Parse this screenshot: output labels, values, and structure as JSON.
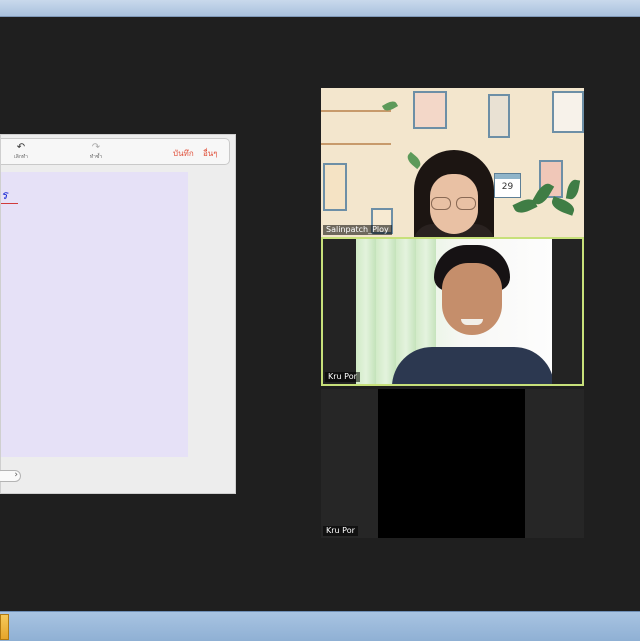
{
  "shared_screen": {
    "toolbar": {
      "undo_label": "เลิกทำ",
      "redo_label": "ทำซ้ำ",
      "save_label": "บันทึก",
      "other_label": "อื่นๆ"
    },
    "ink_text": "ร"
  },
  "participants": [
    {
      "name": "Salinpatch_Ploy",
      "calendar_number": "29"
    },
    {
      "name": "Kru Por",
      "active_speaker": true
    },
    {
      "name": "Kru Por",
      "video": "off"
    }
  ],
  "colors": {
    "active_speaker_border": "#c7e07a",
    "ink": "#1b2bd6",
    "toolbar_accent": "#e0523c"
  }
}
